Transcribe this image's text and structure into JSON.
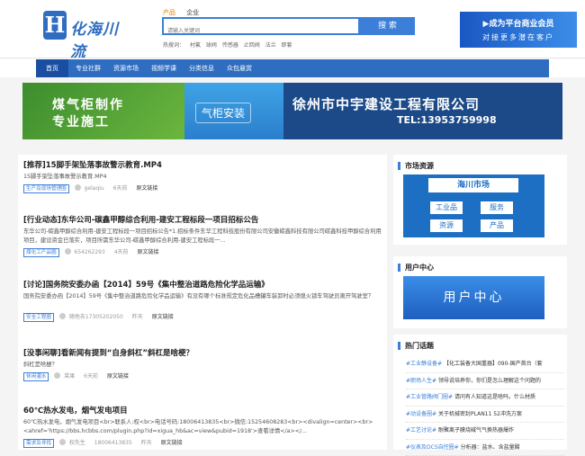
{
  "header": {
    "logo_letter": "H",
    "logo_text": "化海川流",
    "search_tabs": [
      "产品",
      "企业"
    ],
    "search_placeholder": "请输入关键词",
    "search_button": "搜 索",
    "hot_label": "热搜词：",
    "hot_words": [
      "村氟",
      "球阀",
      "传感器",
      "止回阀",
      "法兰",
      "即套"
    ],
    "member_line1": "▶成为平台商业会员",
    "member_line2": "对接更多潜在客户"
  },
  "nav": [
    "首页",
    "专业社群",
    "资源市场",
    "视频学课",
    "分类信息",
    "众包悬赏"
  ],
  "banner": {
    "left_line1": "煤气柜制作",
    "left_line2": "专业施工",
    "mid_text": "气柜安装",
    "company": "徐州市中宇建设工程有限公司",
    "tel": "TEL:13953759998"
  },
  "posts": [
    {
      "title": "[推荐]15脚手架坠落事故警示教育.MP4",
      "desc": "15脚手架坠落事故警示教育.MP4",
      "tag": "生产及现场管理圈",
      "author": "gelaqiu",
      "time": "6天前",
      "link": "原文链接"
    },
    {
      "title": "[行业动态]东华公司-碳鑫甲醇综合利用-建安工程标段一项目招标公告",
      "desc": "东华公司-碳鑫甲醇综合利用-建安工程标段一项目招标公告*1.招标条件东华工程科技股份有限公司安徽碳鑫科技有限公司碳鑫科技甲醇综合利用项目，建设资金已落实，项目所需东华公司-碳鑫甲醇综合利用-建安工程标段一...",
      "tag": "煤化工产品圈",
      "author": "654262293",
      "time": "4天前",
      "link": "原文链接"
    },
    {
      "title": "[讨论]国务院安委办函【2014】59号《集中整治道路危险化学品运输》",
      "desc": "国务院安委办函【2014】59号《集中整治道路危险化学品运输》有没有哪个标准规定危化品槽罐车装卸时必须熄火锁车驾驶员离开驾驶室？",
      "tag": "安全工程圈",
      "author": "随他去17305202050",
      "time": "昨天",
      "link": "原文链接"
    },
    {
      "title": "[没事闲聊]看新闻有提到“自身斜杠”斜杠是啥梗？",
      "desc": "斜杠是啥梗？",
      "tag": "休闲灌水",
      "author": "菜果",
      "time": "6天前",
      "link": "原文链接"
    },
    {
      "title": "60℃热水发电，烟气发电项目",
      "desc": "60℃热水发电，烟气发电项目<br>联系人:权<br>电话号码:18006413835<br>微信:15254608283<br><divalign=center><br><ahref='https://bbs.hcbbs.com/plugin.php?id=xigua_hb&ac=view&pubid=1918'>查看详情</a></...",
      "tag": "需求及寻找",
      "author": "权先生",
      "phone": "18006413835",
      "time": "昨天",
      "link": "原文链接"
    }
  ],
  "sidebar": {
    "market_title": "市场资源",
    "market_head": "海川市场",
    "market_buttons": [
      "工业品",
      "服务",
      "资源",
      "产品"
    ],
    "user_title": "用户中心",
    "user_button": "用户中心",
    "hot_title": "热门话题",
    "hot_topics": [
      {
        "tag": "#工业静设备#",
        "text": "【化工装备大国重器】090-国产首台（套"
      },
      {
        "tag": "#职场人生#",
        "text": "领导说培养你，你们是怎么理解这个问题的"
      },
      {
        "tag": "#工业管路阀门圈#",
        "text": "请问有人知道这是啥吗，什么材质"
      },
      {
        "tag": "#动设备圈#",
        "text": "关于机械密封PLAN11 52冲洗方案"
      },
      {
        "tag": "#工艺讨论#",
        "text": "耐聚离子膜烧碱气气换热器爆炸"
      },
      {
        "tag": "#仪表及DCS自控圈#",
        "text": "分析器：盐水、含盐量酸"
      }
    ]
  }
}
